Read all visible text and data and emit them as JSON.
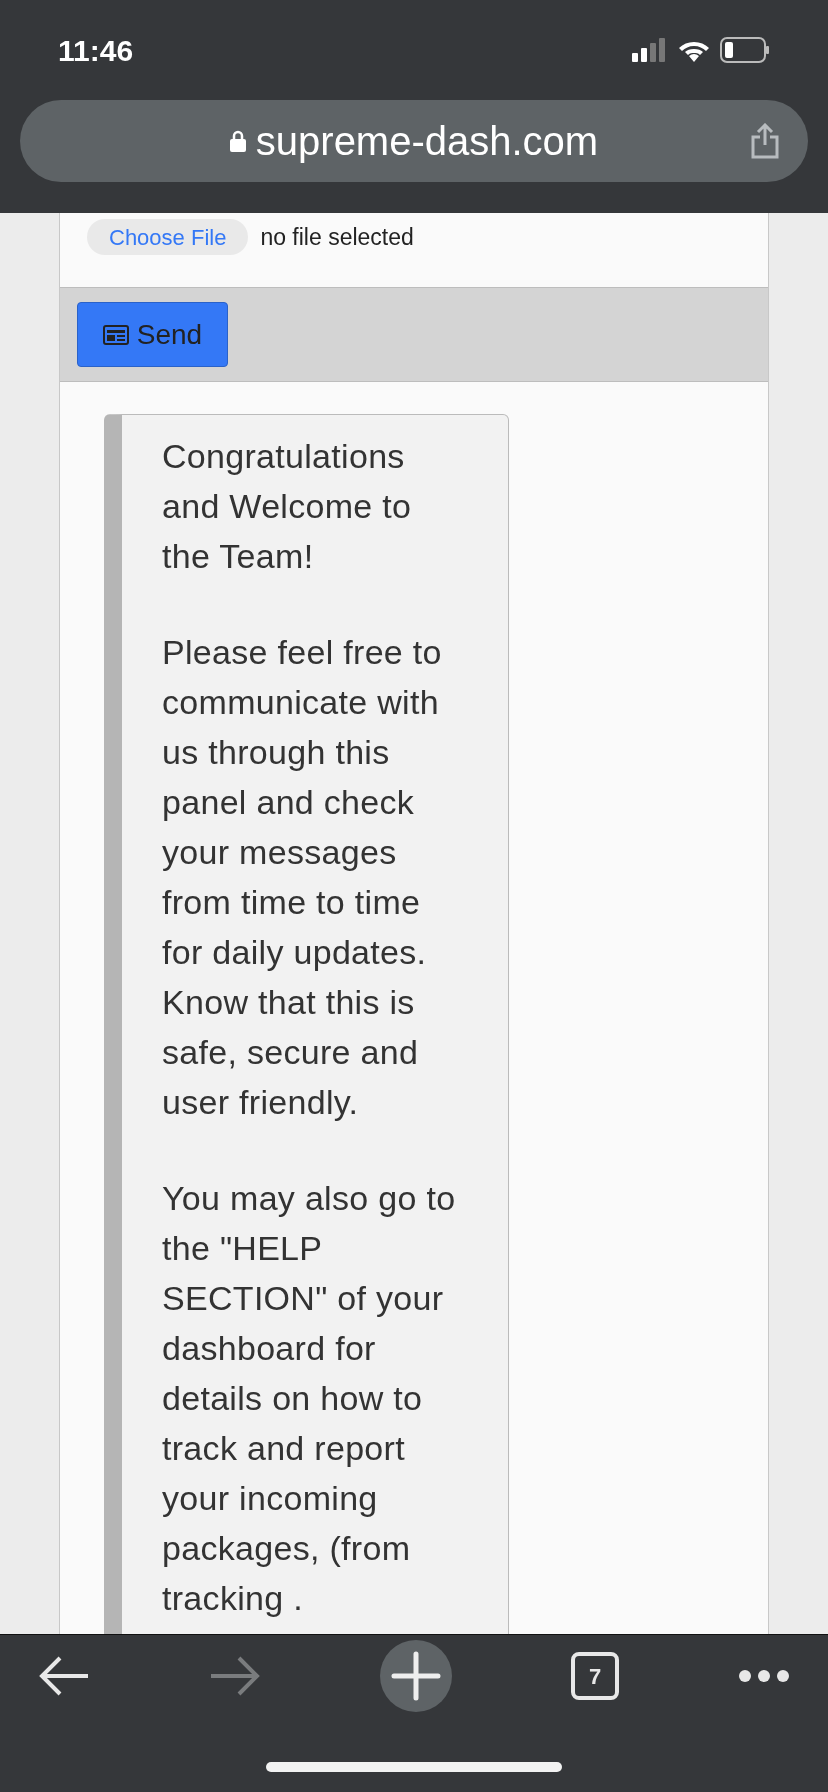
{
  "status_bar": {
    "time": "11:46"
  },
  "address_bar": {
    "url": "supreme-dash.com"
  },
  "file_input": {
    "button": "Choose File",
    "status": "no file selected"
  },
  "send_button": {
    "label": "Send"
  },
  "message": {
    "paragraphs": [
      "Congratulations and Welcome to the Team!",
      "Please feel free to communicate with us through this panel and check your messages from time to time for daily updates. Know that this is safe, secure and user friendly.",
      "You may also go to the \"HELP SECTION\" of your dashboard for details on how to track and report your incoming packages, (from tracking ."
    ]
  },
  "toolbar": {
    "back_disabled": false,
    "forward_disabled": true,
    "tab_count": "7"
  }
}
